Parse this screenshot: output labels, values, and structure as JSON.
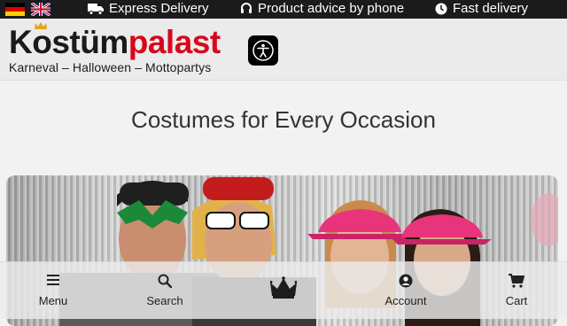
{
  "topbar": {
    "languages": [
      {
        "name": "German",
        "icon": "flag-de"
      },
      {
        "name": "English",
        "icon": "flag-gb"
      }
    ],
    "items": [
      {
        "label": "Express Delivery",
        "icon": "truck-icon"
      },
      {
        "label": "Product advice by phone",
        "icon": "headset-icon"
      },
      {
        "label": "Fast delivery",
        "icon": "clock-icon"
      }
    ]
  },
  "header": {
    "logo": {
      "part1": "Kostüm",
      "part2": "palast",
      "tagline": "Karneval – Halloween – Mottopartys"
    },
    "accessibility_icon": "accessibility-icon"
  },
  "main": {
    "heading": "Costumes for Every Occasion"
  },
  "bottom_nav": {
    "items": [
      {
        "label": "Menu",
        "icon": "menu-icon"
      },
      {
        "label": "Search",
        "icon": "search-icon"
      },
      {
        "label": "",
        "icon": "crown-icon"
      },
      {
        "label": "Account",
        "icon": "account-icon"
      },
      {
        "label": "Cart",
        "icon": "cart-icon"
      }
    ]
  },
  "colors": {
    "brand_red": "#d6081d",
    "topbar_bg": "#1b1b1b",
    "pink_caps": "#e8347a"
  }
}
